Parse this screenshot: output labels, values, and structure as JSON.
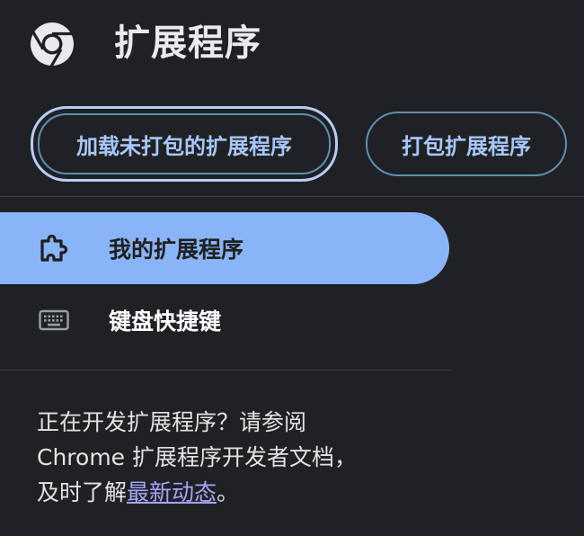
{
  "header": {
    "title": "扩展程序",
    "logo_icon": "chrome-logo-icon"
  },
  "toolbar": {
    "load_unpacked_label": "加载未打包的扩展程序",
    "pack_label": "打包扩展程序"
  },
  "sidebar": {
    "items": [
      {
        "label": "我的扩展程序",
        "icon": "puzzle-piece-icon",
        "active": true
      },
      {
        "label": "键盘快捷键",
        "icon": "keyboard-icon",
        "active": false
      }
    ]
  },
  "footer": {
    "line1": "正在开发扩展程序？请参阅",
    "line2": "Chrome 扩展程序开发者文档，",
    "line3_prefix": "及时了解",
    "link_text": "最新动态",
    "line3_suffix": "。"
  },
  "colors": {
    "background": "#202124",
    "accent": "#8ab4f8",
    "button_text": "#a8c7fa",
    "link": "#a5a5fb"
  }
}
